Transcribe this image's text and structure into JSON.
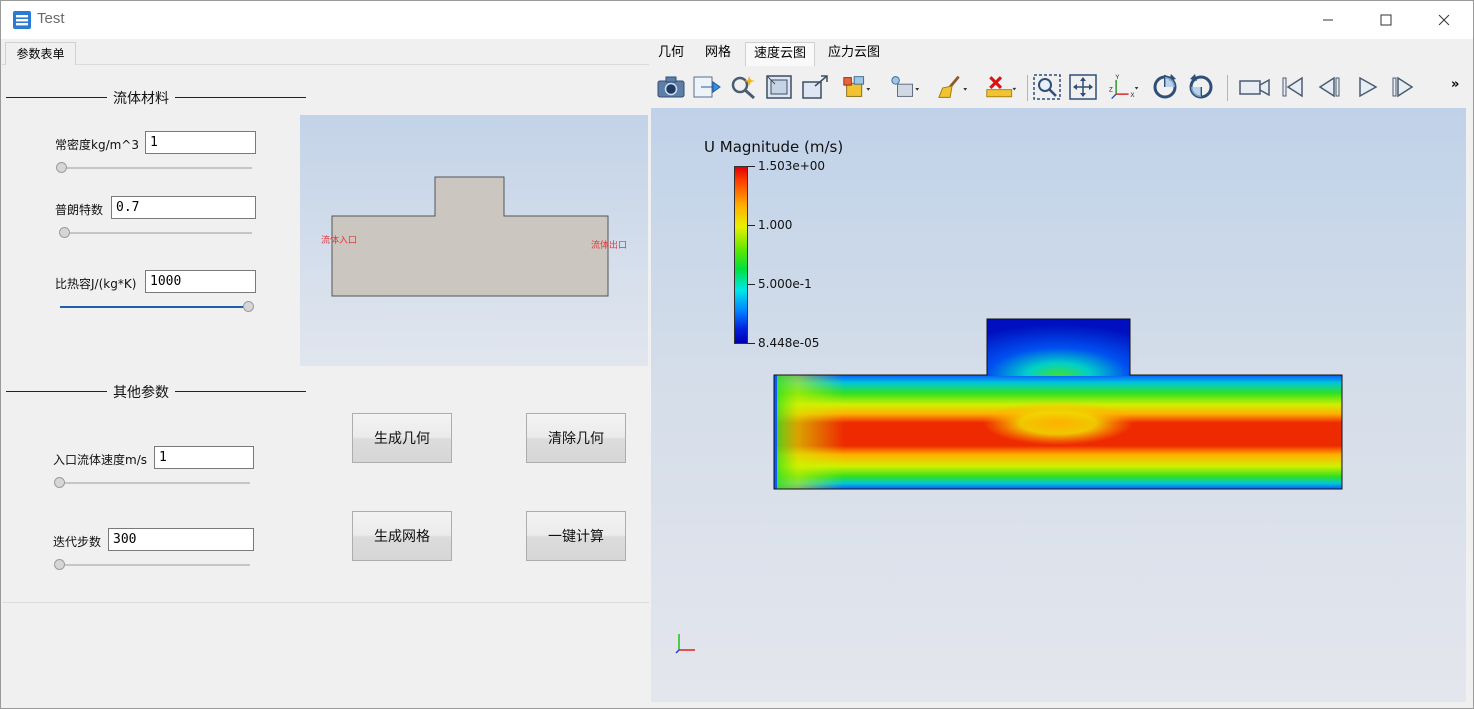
{
  "window": {
    "title": "Test",
    "controls": {
      "minimize": "—",
      "maximize": "☐",
      "close": "✕"
    }
  },
  "left_panel": {
    "tab": "参数表单",
    "fluid_section": {
      "title": "流体材料",
      "fields": [
        {
          "label": "常密度kg/m^3",
          "value": "1",
          "slider_fraction": 0.0
        },
        {
          "label": "普朗特数",
          "value": "0.7",
          "slider_fraction": 0.02
        },
        {
          "label": "比热容J/(kg*K)",
          "value": "1000",
          "slider_fraction": 1.0
        }
      ]
    },
    "preview": {
      "inlet_label": "流体入口",
      "outlet_label": "流体出口"
    },
    "other_section": {
      "title": "其他参数",
      "fields": [
        {
          "label": "入口流体速度m/s",
          "value": "1",
          "slider_fraction": 0.0
        },
        {
          "label": "迭代步数",
          "value": "300",
          "slider_fraction": 0.0
        }
      ]
    },
    "buttons": {
      "generate_geometry": "生成几何",
      "clear_geometry": "清除几何",
      "generate_mesh": "生成网格",
      "one_click_compute": "一键计算"
    }
  },
  "right_panel": {
    "tabs": [
      "几何",
      "网格",
      "速度云图",
      "应力云图"
    ],
    "active_tab": "速度云图",
    "toolbar_icons": [
      "camera-icon",
      "export-icon",
      "magic-wand-icon",
      "frame-icon",
      "box-icon",
      "cube-dropdown-icon",
      "light-dropdown-icon",
      "broom-icon",
      "delete-icon",
      "ruler-icon",
      "zoom-box-icon",
      "fit-view-icon",
      "axes-icon",
      "rotate-cw-icon",
      "rotate-ccw-icon",
      "video-camera-icon",
      "first-frame-icon",
      "prev-frame-icon",
      "play-icon",
      "last-frame-icon"
    ],
    "toolbar_more": "»",
    "legend": {
      "title": "U Magnitude (m/s)",
      "max": "1.503e+00",
      "mid_high": "1.000",
      "mid_low": "5.000e-1",
      "min": "8.448e-05"
    }
  }
}
